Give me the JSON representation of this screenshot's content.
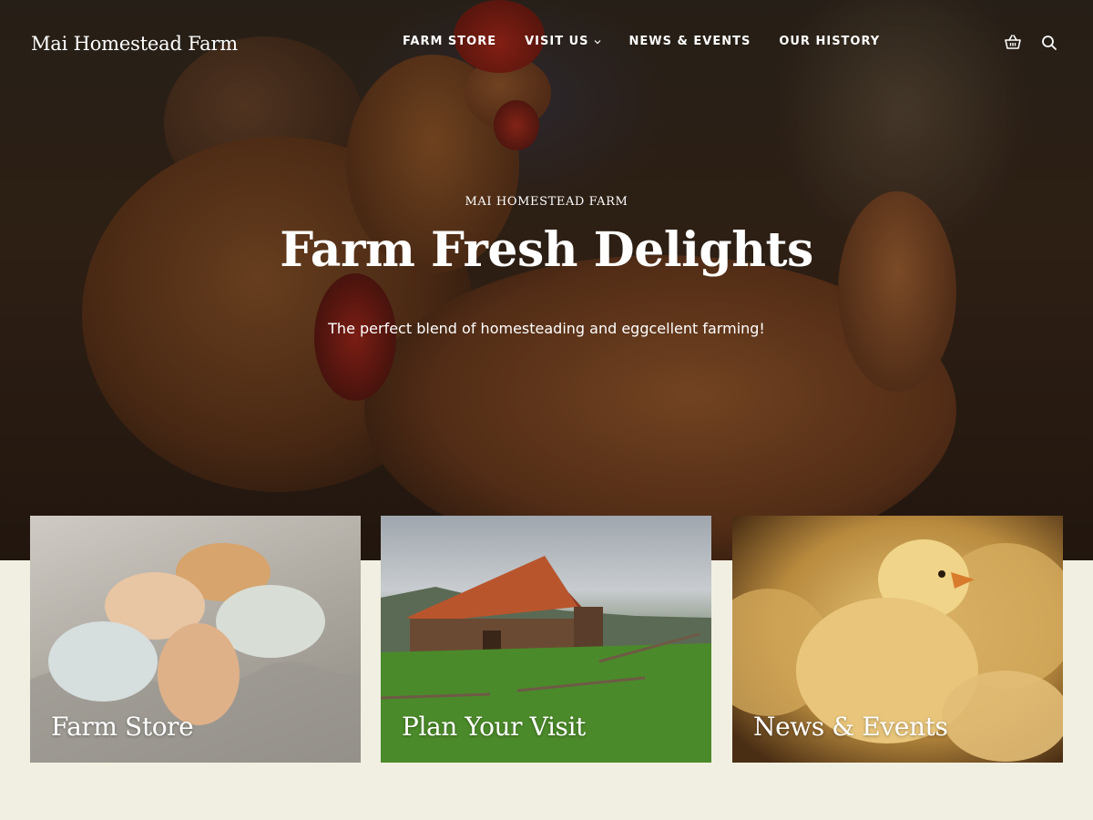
{
  "site": {
    "logo": "Mai Homestead Farm"
  },
  "nav": {
    "items": [
      {
        "label": "FARM STORE"
      },
      {
        "label": "VISIT US",
        "has_dropdown": true
      },
      {
        "label": "NEWS & EVENTS"
      },
      {
        "label": "OUR HISTORY"
      }
    ],
    "icons": [
      "basket-icon",
      "search-icon"
    ]
  },
  "hero": {
    "eyebrow": "MAI HOMESTEAD FARM",
    "title": "Farm Fresh Delights",
    "subtitle": "The perfect blend of homesteading and eggcellent farming!"
  },
  "cards": [
    {
      "label": "Farm Store",
      "image": "eggs-photo"
    },
    {
      "label": "Plan Your Visit",
      "image": "barn-photo"
    },
    {
      "label": "News & Events",
      "image": "chicks-photo"
    }
  ],
  "colors": {
    "page_background": "#f1efe1",
    "text_on_image": "#ffffff"
  }
}
